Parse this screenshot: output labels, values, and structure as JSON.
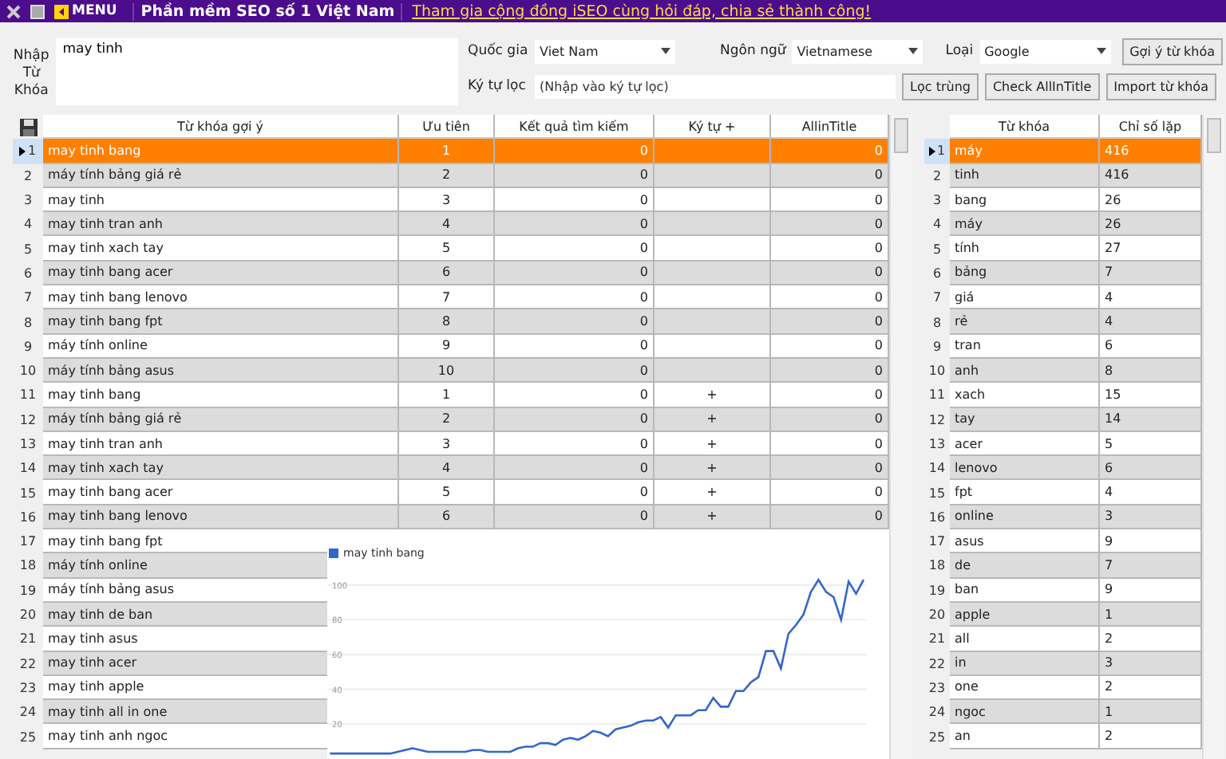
{
  "title_bar": {
    "menu_label": "MENU",
    "title": "Phần mềm SEO số 1 Việt Nam",
    "link": "Tham gia cộng đồng iSEO cùng hỏi đáp, chia sẻ thành công!"
  },
  "form": {
    "keyword_label": "Nhập Từ Khóa",
    "keyword_value": "may tinh",
    "country_label": "Quốc gia",
    "country": "Viet Nam",
    "language_label": "Ngôn ngữ",
    "language": "Vietnamese",
    "type_label": "Loại",
    "type": "Google",
    "filter_label": "Ký tự lọc",
    "filter_placeholder": "(Nhập vào ký tự lọc)",
    "buttons": [
      "Gợi ý từ khóa",
      "Lọc trùng",
      "Check AllInTitle",
      "Import từ khóa"
    ]
  },
  "suggestions": {
    "columns": [
      "Từ khóa gợi ý",
      "Ưu tiên",
      "Kết quả tìm kiếm",
      "Ký tự +",
      "AllinTitle"
    ],
    "rows": [
      {
        "n": "1",
        "keyword": "may tinh bang",
        "priority": "1",
        "results": "0",
        "plus": "",
        "allintitle": "0",
        "selected": true
      },
      {
        "n": "2",
        "keyword": "máy tính bảng giá rẻ",
        "priority": "2",
        "results": "0",
        "plus": "",
        "allintitle": "0",
        "selected": false
      },
      {
        "n": "3",
        "keyword": "may tinh",
        "priority": "3",
        "results": "0",
        "plus": "",
        "allintitle": "0",
        "selected": false
      },
      {
        "n": "4",
        "keyword": "may tinh tran anh",
        "priority": "4",
        "results": "0",
        "plus": "",
        "allintitle": "0",
        "selected": false
      },
      {
        "n": "5",
        "keyword": "may tinh xach tay",
        "priority": "5",
        "results": "0",
        "plus": "",
        "allintitle": "0",
        "selected": false
      },
      {
        "n": "6",
        "keyword": "may tinh bang acer",
        "priority": "6",
        "results": "0",
        "plus": "",
        "allintitle": "0",
        "selected": false
      },
      {
        "n": "7",
        "keyword": "may tinh bang lenovo",
        "priority": "7",
        "results": "0",
        "plus": "",
        "allintitle": "0",
        "selected": false
      },
      {
        "n": "8",
        "keyword": "may tinh bang fpt",
        "priority": "8",
        "results": "0",
        "plus": "",
        "allintitle": "0",
        "selected": false
      },
      {
        "n": "9",
        "keyword": "máy tính online",
        "priority": "9",
        "results": "0",
        "plus": "",
        "allintitle": "0",
        "selected": false
      },
      {
        "n": "10",
        "keyword": "máy tính bảng asus",
        "priority": "10",
        "results": "0",
        "plus": "",
        "allintitle": "0",
        "selected": false
      },
      {
        "n": "11",
        "keyword": "may tinh bang",
        "priority": "1",
        "results": "0",
        "plus": "+",
        "allintitle": "0",
        "selected": false
      },
      {
        "n": "12",
        "keyword": "máy tính bảng giá rẻ",
        "priority": "2",
        "results": "0",
        "plus": "+",
        "allintitle": "0",
        "selected": false
      },
      {
        "n": "13",
        "keyword": "may tinh tran anh",
        "priority": "3",
        "results": "0",
        "plus": "+",
        "allintitle": "0",
        "selected": false
      },
      {
        "n": "14",
        "keyword": "may tinh xach tay",
        "priority": "4",
        "results": "0",
        "plus": "+",
        "allintitle": "0",
        "selected": false
      },
      {
        "n": "15",
        "keyword": "may tinh bang acer",
        "priority": "5",
        "results": "0",
        "plus": "+",
        "allintitle": "0",
        "selected": false
      },
      {
        "n": "16",
        "keyword": "may tinh bang lenovo",
        "priority": "6",
        "results": "0",
        "plus": "+",
        "allintitle": "0",
        "selected": false
      },
      {
        "n": "17",
        "keyword": "may tinh bang fpt",
        "selected": false
      },
      {
        "n": "18",
        "keyword": "máy tính online",
        "selected": false
      },
      {
        "n": "19",
        "keyword": "máy tính bảng asus",
        "selected": false
      },
      {
        "n": "20",
        "keyword": "may tinh de ban",
        "selected": false
      },
      {
        "n": "21",
        "keyword": "may tinh asus",
        "selected": false
      },
      {
        "n": "22",
        "keyword": "may tinh acer",
        "selected": false
      },
      {
        "n": "23",
        "keyword": "may tinh apple",
        "selected": false
      },
      {
        "n": "24",
        "keyword": "may tinh all in one",
        "selected": false
      },
      {
        "n": "25",
        "keyword": "may tinh anh ngoc",
        "selected": false
      }
    ],
    "chart_data": {
      "type": "line",
      "ylim": [
        -14,
        132
      ],
      "yticks": [
        20,
        40,
        60,
        80,
        100
      ],
      "grid": true,
      "series": [
        {
          "name": "may tinh bang",
          "color": "#3366cc",
          "values": [
            3,
            3,
            3,
            3,
            3,
            3,
            3,
            3,
            3,
            4,
            5,
            6,
            5,
            4,
            4,
            4,
            4,
            4,
            4,
            5,
            5,
            4,
            4,
            4,
            4,
            6,
            7,
            7,
            9,
            9,
            8,
            11,
            12,
            11,
            13,
            16,
            15,
            13,
            17,
            18,
            19,
            21,
            22,
            22,
            24,
            18,
            25,
            25,
            25,
            28,
            28,
            35,
            30,
            30,
            39,
            39,
            44,
            47,
            62,
            62,
            52,
            72,
            77,
            83,
            96,
            103,
            96,
            93,
            80,
            102,
            95,
            103
          ]
        }
      ]
    }
  },
  "word_counts": {
    "columns": [
      "Từ khóa",
      "Chỉ số lặp"
    ],
    "rows": [
      {
        "n": "1",
        "word": "máy",
        "count": "416",
        "selected": true
      },
      {
        "n": "2",
        "word": "tinh",
        "count": "416",
        "selected": false
      },
      {
        "n": "3",
        "word": "bang",
        "count": "26",
        "selected": false
      },
      {
        "n": "4",
        "word": "máy",
        "count": "26",
        "selected": false
      },
      {
        "n": "5",
        "word": "tính",
        "count": "27",
        "selected": false
      },
      {
        "n": "6",
        "word": "bảng",
        "count": "7",
        "selected": false
      },
      {
        "n": "7",
        "word": "giá",
        "count": "4",
        "selected": false
      },
      {
        "n": "8",
        "word": "rẻ",
        "count": "4",
        "selected": false
      },
      {
        "n": "9",
        "word": "tran",
        "count": "6",
        "selected": false
      },
      {
        "n": "10",
        "word": "anh",
        "count": "8",
        "selected": false
      },
      {
        "n": "11",
        "word": "xach",
        "count": "15",
        "selected": false
      },
      {
        "n": "12",
        "word": "tay",
        "count": "14",
        "selected": false
      },
      {
        "n": "13",
        "word": "acer",
        "count": "5",
        "selected": false
      },
      {
        "n": "14",
        "word": "lenovo",
        "count": "6",
        "selected": false
      },
      {
        "n": "15",
        "word": "fpt",
        "count": "4",
        "selected": false
      },
      {
        "n": "16",
        "word": "online",
        "count": "3",
        "selected": false
      },
      {
        "n": "17",
        "word": "asus",
        "count": "9",
        "selected": false
      },
      {
        "n": "18",
        "word": "de",
        "count": "7",
        "selected": false
      },
      {
        "n": "19",
        "word": "ban",
        "count": "9",
        "selected": false
      },
      {
        "n": "20",
        "word": "apple",
        "count": "1",
        "selected": false
      },
      {
        "n": "21",
        "word": "all",
        "count": "2",
        "selected": false
      },
      {
        "n": "22",
        "word": "in",
        "count": "3",
        "selected": false
      },
      {
        "n": "23",
        "word": "one",
        "count": "2",
        "selected": false
      },
      {
        "n": "24",
        "word": "ngoc",
        "count": "1",
        "selected": false
      },
      {
        "n": "25",
        "word": "an",
        "count": "2",
        "selected": false
      }
    ]
  }
}
